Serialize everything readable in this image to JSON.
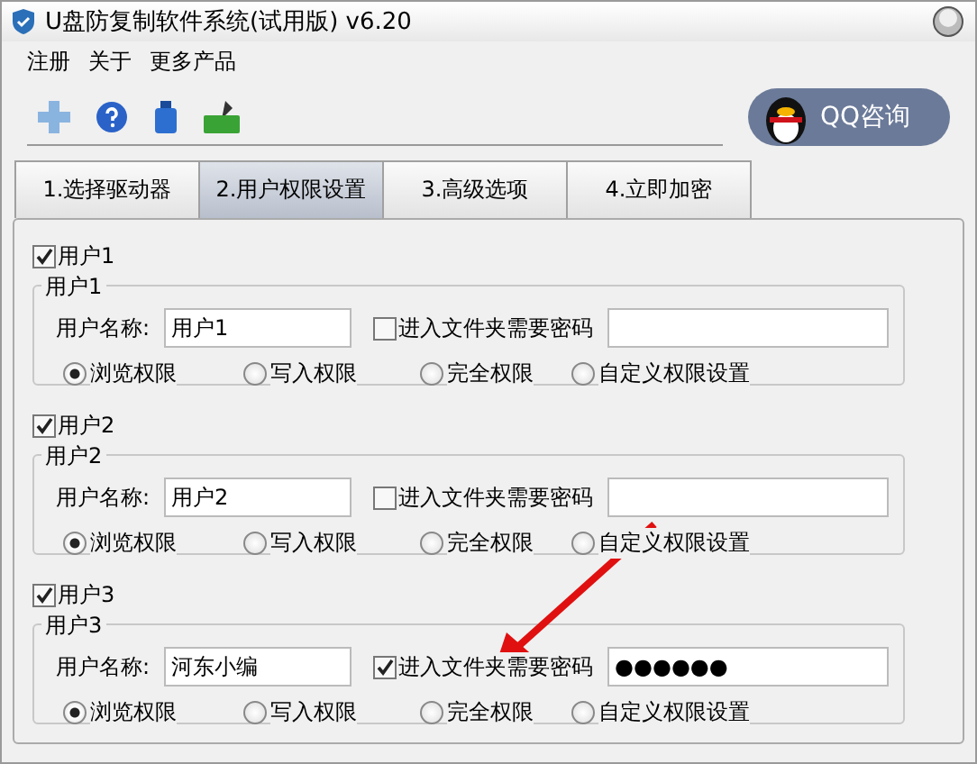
{
  "window": {
    "title": "U盘防复制软件系统(试用版) v6.20"
  },
  "menu": [
    {
      "label": "注册"
    },
    {
      "label": "关于"
    },
    {
      "label": "更多产品"
    }
  ],
  "qq_button": {
    "label": "QQ咨询"
  },
  "tabs": [
    {
      "label": "1.选择驱动器",
      "selected": false
    },
    {
      "label": "2.用户权限设置",
      "selected": true
    },
    {
      "label": "3.高级选项",
      "selected": false
    },
    {
      "label": "4.立即加密",
      "selected": false
    }
  ],
  "users": [
    {
      "enabled": true,
      "check_label": "用户1",
      "group_label": "用户1",
      "name_label": "用户名称:",
      "name_value": "用户1",
      "password_required": false,
      "password_label": "进入文件夹需要密码",
      "permissions": [
        {
          "label": "浏览权限",
          "selected": true
        },
        {
          "label": "写入权限",
          "selected": false
        },
        {
          "label": "完全权限",
          "selected": false
        },
        {
          "label": "自定义权限设置",
          "selected": false
        }
      ]
    },
    {
      "enabled": true,
      "check_label": "用户2",
      "group_label": "用户2",
      "name_label": "用户名称:",
      "name_value": "用户2",
      "password_required": false,
      "password_label": "进入文件夹需要密码",
      "permissions": [
        {
          "label": "浏览权限",
          "selected": true
        },
        {
          "label": "写入权限",
          "selected": false
        },
        {
          "label": "完全权限",
          "selected": false
        },
        {
          "label": "自定义权限设置",
          "selected": false
        }
      ]
    },
    {
      "enabled": true,
      "check_label": "用户3",
      "group_label": "用户3",
      "name_label": "用户名称:",
      "name_value": "河东小编",
      "password_required": true,
      "password_label": "进入文件夹需要密码",
      "password_value": "●●●●●●",
      "permissions": [
        {
          "label": "浏览权限",
          "selected": true
        },
        {
          "label": "写入权限",
          "selected": false
        },
        {
          "label": "完全权限",
          "selected": false
        },
        {
          "label": "自定义权限设置",
          "selected": false
        }
      ]
    }
  ]
}
